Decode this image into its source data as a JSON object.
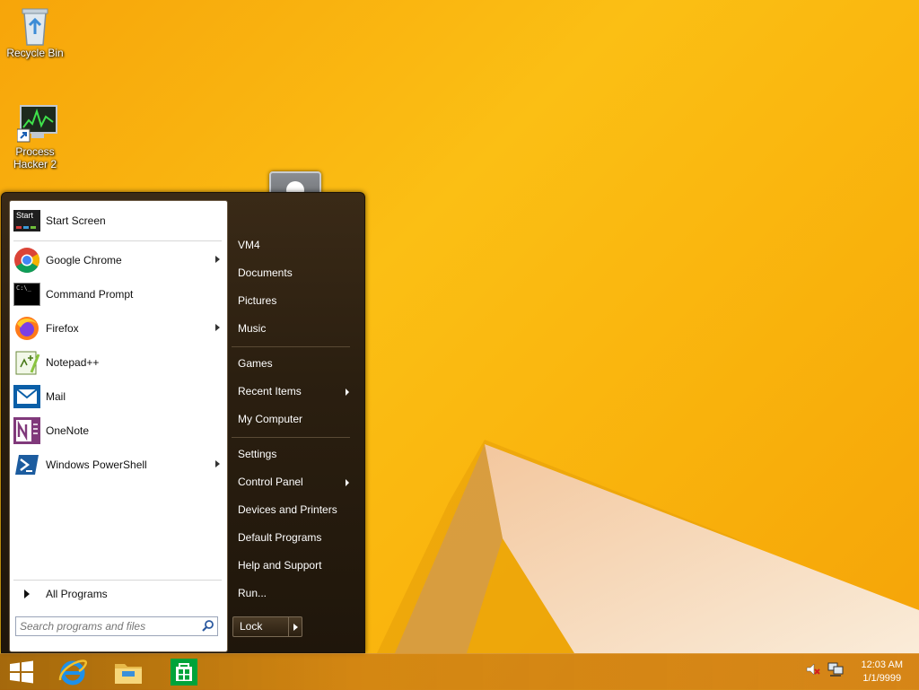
{
  "desktop": {
    "icons": [
      {
        "label": "Recycle Bin",
        "icon": "recycle-bin-icon"
      },
      {
        "label_line1": "Process",
        "label_line2": "Hacker 2",
        "icon": "process-hacker-icon"
      }
    ]
  },
  "start_menu": {
    "pinned": [
      {
        "label": "Start Screen",
        "icon": "start-screen-icon",
        "submenu": false
      },
      {
        "label": "Google Chrome",
        "icon": "chrome-icon",
        "submenu": true
      },
      {
        "label": "Command Prompt",
        "icon": "cmd-icon",
        "submenu": false
      },
      {
        "label": "Firefox",
        "icon": "firefox-icon",
        "submenu": true
      },
      {
        "label": "Notepad++",
        "icon": "notepadpp-icon",
        "submenu": false
      },
      {
        "label": "Mail",
        "icon": "mail-icon",
        "submenu": false
      },
      {
        "label": "OneNote",
        "icon": "onenote-icon",
        "submenu": false
      },
      {
        "label": "Windows PowerShell",
        "icon": "powershell-icon",
        "submenu": true
      }
    ],
    "start_tile_text": "Start",
    "all_programs": "All Programs",
    "search_placeholder": "Search programs and files",
    "right": [
      {
        "label": "VM4",
        "submenu": false
      },
      {
        "label": "Documents",
        "submenu": false
      },
      {
        "label": "Pictures",
        "submenu": false
      },
      {
        "label": "Music",
        "submenu": false
      },
      {
        "label": "Games",
        "submenu": false
      },
      {
        "label": "Recent Items",
        "submenu": true
      },
      {
        "label": "My Computer",
        "submenu": false
      },
      {
        "label": "Settings",
        "submenu": false
      },
      {
        "label": "Control Panel",
        "submenu": true
      },
      {
        "label": "Devices and Printers",
        "submenu": false
      },
      {
        "label": "Default Programs",
        "submenu": false
      },
      {
        "label": "Help and Support",
        "submenu": false
      },
      {
        "label": "Run...",
        "submenu": false
      }
    ],
    "lock_label": "Lock"
  },
  "taskbar": {
    "clock_time": "12:03 AM",
    "clock_date": "1/1/9999"
  },
  "colors": {
    "wallpaper": "#f9b20c",
    "menu_dark": "#2b1f10",
    "taskbar": "#c0780f"
  }
}
